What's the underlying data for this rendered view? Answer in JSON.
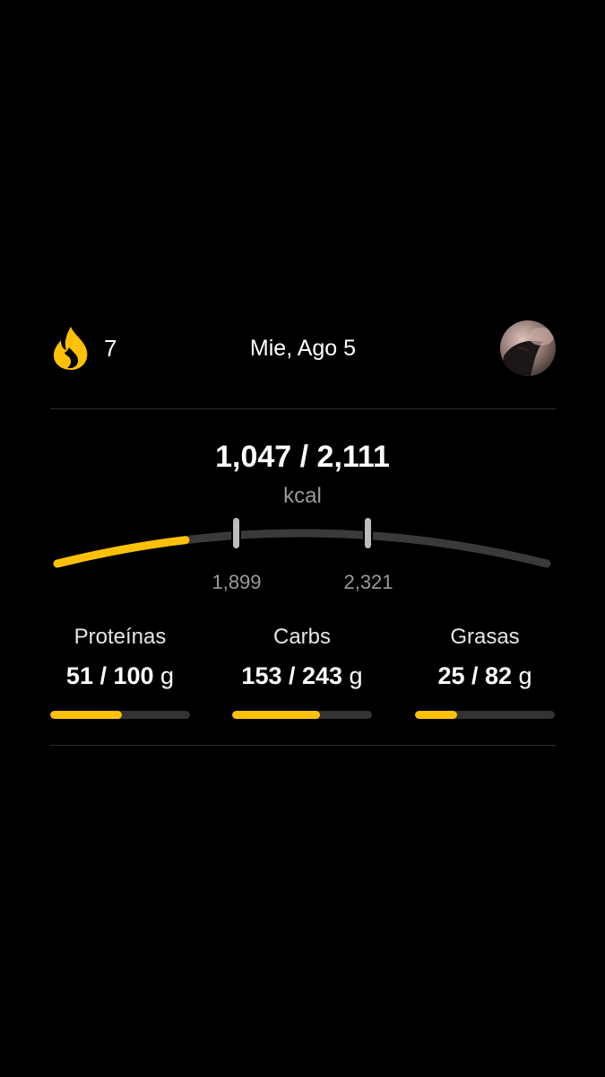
{
  "header": {
    "streak_count": "7",
    "streak_icon": "flame-icon",
    "date": "Mie, Ago 5",
    "avatar_icon": "profile-avatar"
  },
  "calories": {
    "consumed": 1047,
    "goal": 2111,
    "display": "1,047 / 2,111",
    "unit": "kcal",
    "range_low_label": "1,899",
    "range_high_label": "2,321",
    "range_low": 1899,
    "range_high": 2321
  },
  "macros": [
    {
      "name": "Proteínas",
      "value": "51 / 100",
      "unit": "g",
      "consumed": 51,
      "goal": 100,
      "fraction": 0.51
    },
    {
      "name": "Carbs",
      "value": "153 / 243",
      "unit": "g",
      "consumed": 153,
      "goal": 243,
      "fraction": 0.63
    },
    {
      "name": "Grasas",
      "value": "25 / 82",
      "unit": "g",
      "consumed": 25,
      "goal": 82,
      "fraction": 0.3
    }
  ],
  "colors": {
    "accent": "#FFC107",
    "track": "#3A3A3C",
    "background": "#000000",
    "muted_text": "#9A9A9E"
  }
}
